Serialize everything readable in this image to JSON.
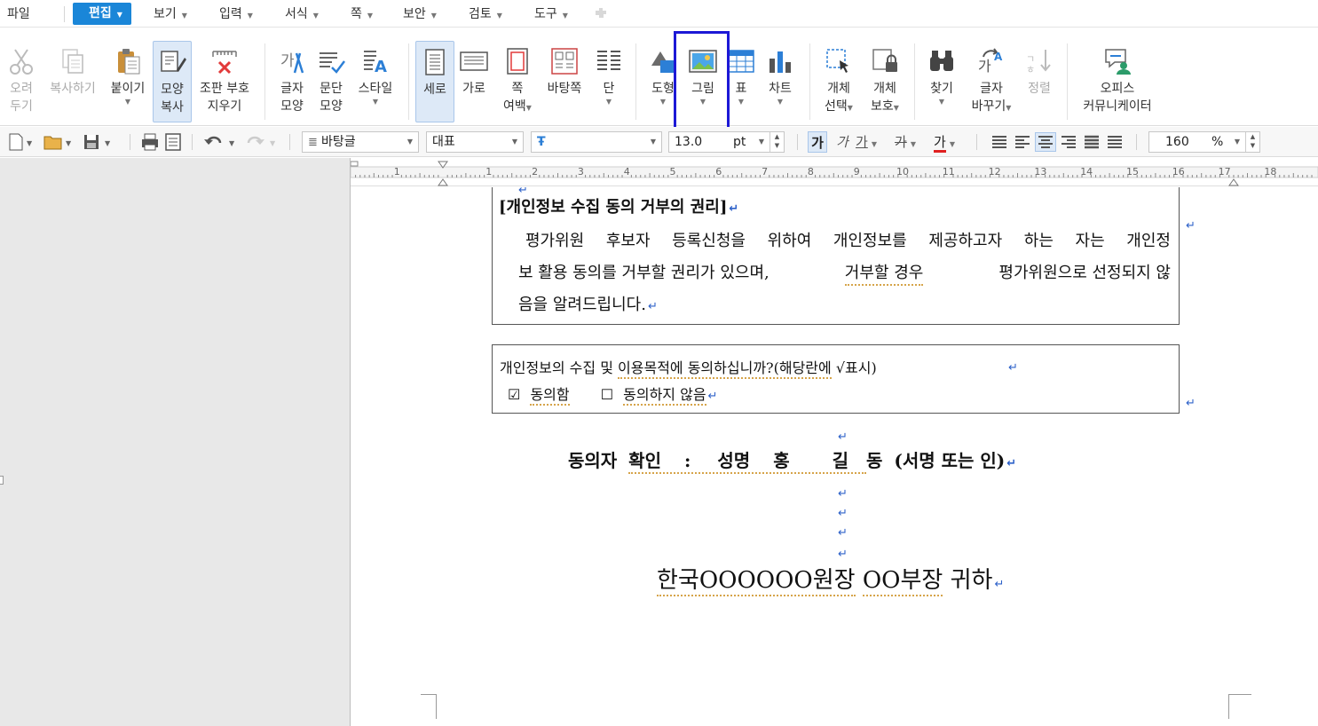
{
  "menu": {
    "items": [
      {
        "label": "파일",
        "arrow": false
      },
      {
        "label": "편집",
        "arrow": true,
        "active": true
      },
      {
        "label": "보기",
        "arrow": true
      },
      {
        "label": "입력",
        "arrow": true
      },
      {
        "label": "서식",
        "arrow": true
      },
      {
        "label": "쪽",
        "arrow": true
      },
      {
        "label": "보안",
        "arrow": true
      },
      {
        "label": "검토",
        "arrow": true
      },
      {
        "label": "도구",
        "arrow": true
      }
    ]
  },
  "ribbon": {
    "cut": {
      "line1": "오려",
      "line2": "두기"
    },
    "copy": {
      "line1": "복사하기"
    },
    "paste": {
      "line1": "붙이기"
    },
    "format_copy": {
      "line1": "모양",
      "line2": "복사"
    },
    "clear_codes": {
      "line1": "조판 부호",
      "line2": "지우기"
    },
    "char_shape": {
      "line1": "글자",
      "line2": "모양"
    },
    "para_shape": {
      "line1": "문단",
      "line2": "모양"
    },
    "style": {
      "line1": "스타일"
    },
    "portrait": {
      "line1": "세로"
    },
    "landscape": {
      "line1": "가로"
    },
    "page_margin": {
      "line1": "쪽",
      "line2": "여백"
    },
    "background": {
      "line1": "바탕쪽"
    },
    "columns": {
      "line1": "단"
    },
    "shape": {
      "line1": "도형"
    },
    "picture": {
      "line1": "그림"
    },
    "table": {
      "line1": "표"
    },
    "chart": {
      "line1": "차트"
    },
    "select_object": {
      "line1": "개체",
      "line2": "선택"
    },
    "protect_object": {
      "line1": "개체",
      "line2": "보호"
    },
    "find": {
      "line1": "찾기"
    },
    "replace": {
      "line1": "글자",
      "line2": "바꾸기"
    },
    "sort": {
      "line1": "정렬"
    },
    "office_comm": {
      "line1": "오피스",
      "line2": "커뮤니케이터"
    }
  },
  "toolbar": {
    "style_combo": "바탕글",
    "lang_combo": "대표",
    "font_combo": "",
    "size_value": "13.0",
    "size_unit": "pt",
    "zoom_value": "160",
    "zoom_unit": "%",
    "bold_glyph": "가",
    "italic_glyph": "가",
    "underline_glyph": "가",
    "strike_glyph": "가",
    "color_glyph": "가"
  },
  "ruler": {
    "left_numbers": [
      "1"
    ],
    "numbers": [
      "1",
      "2",
      "3",
      "4",
      "5",
      "6",
      "7",
      "8",
      "9",
      "10",
      "11",
      "12",
      "13",
      "14",
      "15",
      "16",
      "17",
      "18"
    ]
  },
  "document": {
    "section_title": "[개인정보 수집 동의 거부의 권리]",
    "para_line1": "평가위원 후보자 등록신청을 위하여 개인정보를 제공하고자 하는 자는 개인정",
    "para_line2_a": "보 활용 동의를 거부할 권리가 있으며,",
    "para_line2_b": "거부할 경우",
    "para_line2_c": "평가위원으로 선정되지 않",
    "para_line3": "음을 알려드립니다.",
    "question_a": "개인정보의 수집 및",
    "question_b": "이용목적에 동의하십니까?(해당란에",
    "question_c": "√표시)",
    "agree_box": "☑",
    "agree_label": "동의함",
    "disagree_box": "☐",
    "disagree_label": "동의하지 않음",
    "consent_a": "동의자",
    "consent_b": "확인",
    "consent_c": ":",
    "consent_d": "성명",
    "consent_e": "홍",
    "consent_f": "길",
    "consent_g": "동",
    "consent_h": "(서명 또는 인)",
    "addressee_a": "한국OOOOOO원장",
    "addressee_b": "OO부장",
    "addressee_c": "귀하",
    "return_mark": "↵"
  }
}
